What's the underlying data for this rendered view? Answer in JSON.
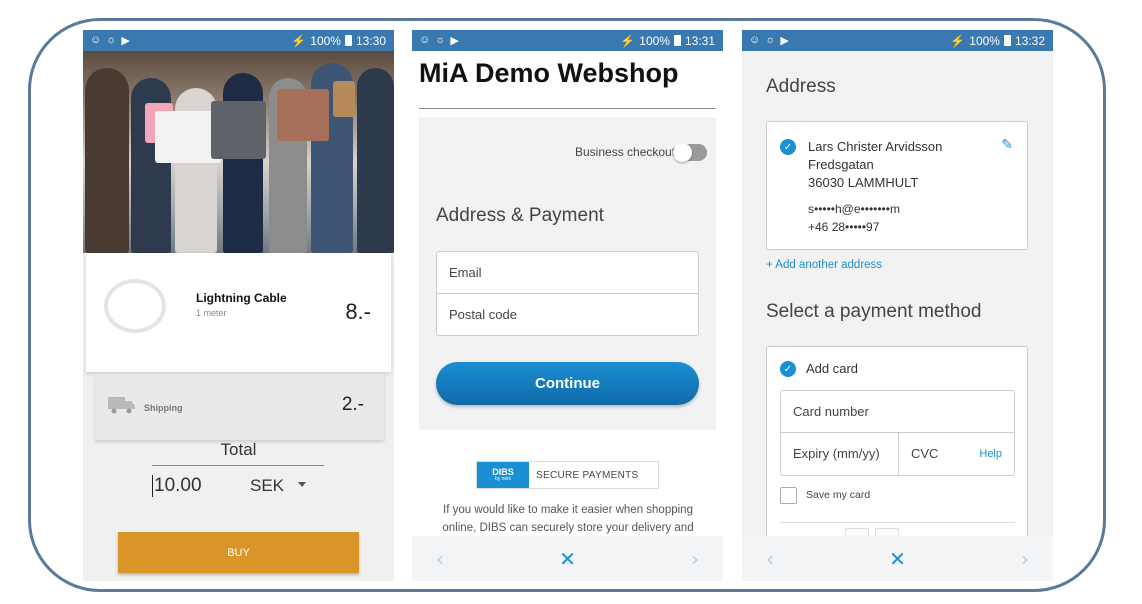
{
  "status_bars": [
    {
      "right_text": "100%",
      "time": "13:30"
    },
    {
      "right_text": "100%",
      "time": "13:31"
    },
    {
      "right_text": "100%",
      "time": "13:32"
    }
  ],
  "cart": {
    "product": {
      "name": "Lightning Cable",
      "subtitle": "1 meter",
      "price": "8.-"
    },
    "shipping": {
      "label": "Shipping",
      "price": "2.-"
    },
    "total_label": "Total",
    "total_value": "10.00",
    "currency": "SEK",
    "buy_label": "BUY"
  },
  "checkout": {
    "shop_title": "MiA Demo Webshop",
    "business_checkout_label": "Business checkout",
    "section_title": "Address & Payment",
    "email_label": "Email",
    "postal_code_label": "Postal code",
    "continue_label": "Continue",
    "dibs_logo_text": "DIBS",
    "dibs_logo_sub": "by nets",
    "secure_payments_label": "SECURE PAYMENTS",
    "dibs_text": "If you would like to make it easier when shopping online, DIBS can securely store your delivery and"
  },
  "payment": {
    "address_title": "Address",
    "address": {
      "name": "Lars Christer Arvidsson",
      "street": "Fredsgatan",
      "city": "36030 LAMMHULT",
      "email": "s•••••h@e•••••••m",
      "phone": "+46 28•••••97"
    },
    "add_address_label": "+ Add another address",
    "payment_title": "Select a payment method",
    "add_card_label": "Add card",
    "card_number_label": "Card number",
    "expiry_label": "Expiry (mm/yy)",
    "cvc_label": "CVC",
    "help_label": "Help",
    "save_card_label": "Save my card"
  },
  "nav": {
    "prev_icon": "‹",
    "close_icon": "✕",
    "next_icon": "›"
  },
  "colors": {
    "status_bar": "#3a79b0",
    "accent_blue": "#1a8fd2",
    "buy_orange": "#d99527"
  }
}
